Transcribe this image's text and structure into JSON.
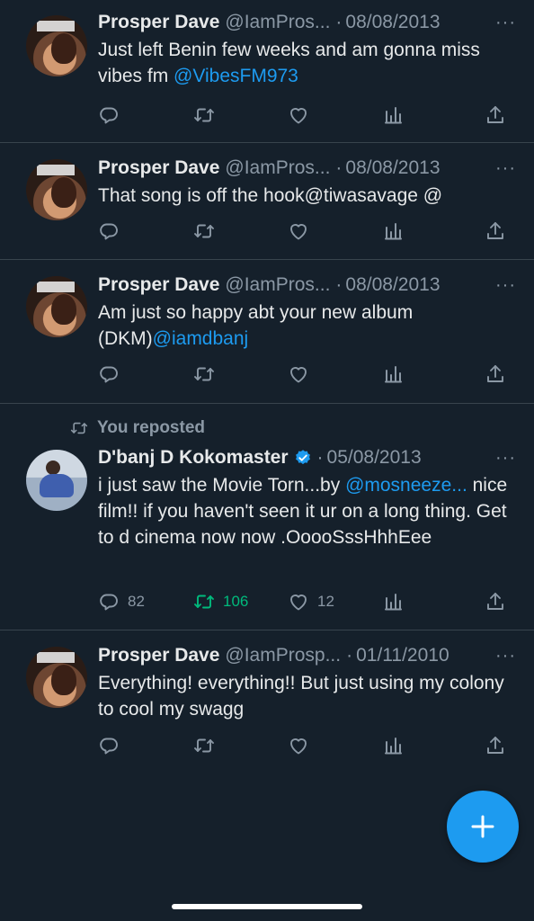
{
  "theme": {
    "background": "#15202b",
    "text": "#e7e9ea",
    "muted": "#8b98a5",
    "accent": "#1d9bf0",
    "repost": "#00ba7c"
  },
  "more_icon": "···",
  "tweets": [
    {
      "name": "Prosper Dave",
      "handle": "@IamPros...",
      "dot": "·",
      "date": "08/08/2013",
      "text": "Just left Benin few weeks and am gonna miss vibes fm ",
      "mention": "@VibesFM973",
      "text2": ""
    },
    {
      "name": "Prosper Dave",
      "handle": "@IamPros...",
      "dot": "·",
      "date": "08/08/2013",
      "text": "That song is off the hook@tiwasavage @",
      "mention": "",
      "text2": ""
    },
    {
      "name": "Prosper Dave",
      "handle": "@IamPros...",
      "dot": "·",
      "date": "08/08/2013",
      "text": "Am just so happy abt your new album (DKM)",
      "mention": "@iamdbanj",
      "text2": ""
    },
    {
      "repost_label": "You reposted",
      "name": "D'banj D Kokomaster",
      "dot": "·",
      "date": "05/08/2013",
      "text": "i just saw the Movie Torn...by ",
      "mention": "@mosneeze...",
      "text2": " nice film!! if you haven't seen it ur on a long thing. Get to d cinema now now .OoooSssHhhEee",
      "reply_count": "82",
      "repost_count": "106",
      "like_count": "12"
    },
    {
      "name": "Prosper Dave",
      "handle": "@IamProsp...",
      "dot": "·",
      "date": "01/11/2010",
      "text": "Everything! everything!! But just using my colony to cool my swagg",
      "mention": "",
      "text2": ""
    }
  ],
  "fab_icon": "compose-plus",
  "icons": [
    "reply-icon",
    "repost-icon",
    "like-icon",
    "views-icon",
    "share-icon",
    "verified-icon"
  ]
}
